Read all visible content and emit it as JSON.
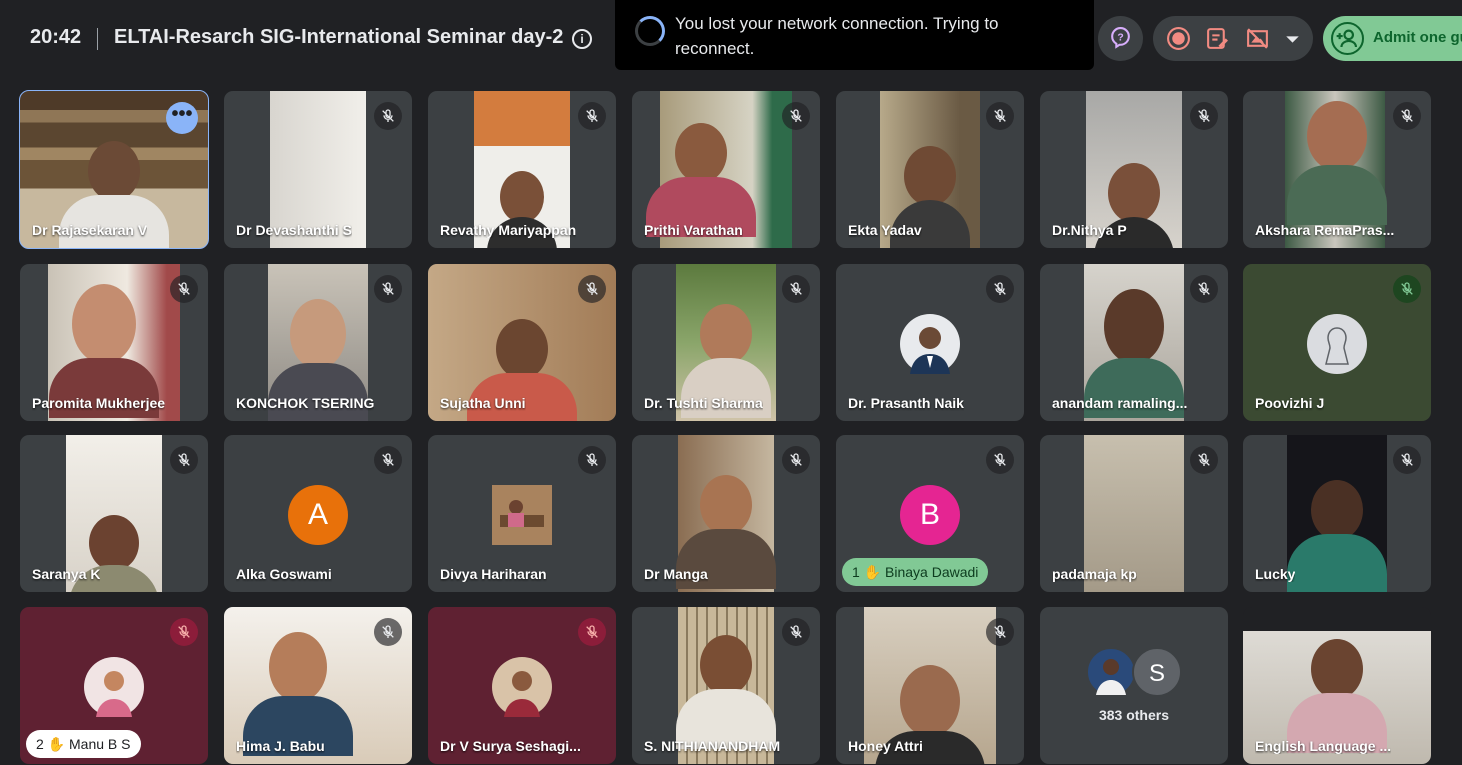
{
  "header": {
    "time": "20:42",
    "meeting_title": "ELTAI-Resarch SIG-International Seminar day-2",
    "info_icon": "info-icon"
  },
  "network_banner": {
    "message": "You lost your network connection. Trying to reconnect."
  },
  "controls": {
    "help_icon": "question-icon",
    "record_icon": "record-icon",
    "notes_icon": "notes-icon",
    "effects_off_icon": "effects-off-icon",
    "dropdown_icon": "chevron-down-icon",
    "admit_label": "Admit one gu"
  },
  "participants": [
    {
      "name": "Dr Rajasekaran V",
      "status": "more"
    },
    {
      "name": "Dr Devashanthi S",
      "status": "muted"
    },
    {
      "name": "Revathy Mariyappan",
      "status": "muted"
    },
    {
      "name": "Prithi Varathan",
      "status": "muted"
    },
    {
      "name": "Ekta Yadav",
      "status": "muted"
    },
    {
      "name": "Dr.Nithya P",
      "status": "muted"
    },
    {
      "name": "Akshara RemaPras...",
      "status": "muted"
    },
    {
      "name": "Paromita Mukherjee",
      "status": "muted"
    },
    {
      "name": "KONCHOK TSERING",
      "status": "muted"
    },
    {
      "name": "Sujatha Unni",
      "status": "muted"
    },
    {
      "name": "Dr. Tushti Sharma",
      "status": "muted"
    },
    {
      "name": "Dr. Prasanth Naik",
      "status": "muted"
    },
    {
      "name": "anandam ramaling...",
      "status": "muted"
    },
    {
      "name": "Poovizhi J",
      "status": "muted"
    },
    {
      "name": "Saranya K",
      "status": "muted"
    },
    {
      "name": "Alka Goswami",
      "status": "muted",
      "initial": "A"
    },
    {
      "name": "Divya Hariharan",
      "status": "muted"
    },
    {
      "name": "Dr Manga",
      "status": "muted"
    },
    {
      "name": "Binaya Dawadi",
      "status": "muted",
      "initial": "B",
      "hand_count": "1"
    },
    {
      "name": "padamaja kp",
      "status": "muted"
    },
    {
      "name": "Lucky",
      "status": "muted"
    },
    {
      "name": "Manu B S",
      "status": "muted",
      "hand_count": "2"
    },
    {
      "name": "Hima J. Babu",
      "status": "muted"
    },
    {
      "name": "Dr V Surya Seshagi...",
      "status": "muted"
    },
    {
      "name": "S. NITHIANANDHAM",
      "status": "muted"
    },
    {
      "name": "Honey Attri",
      "status": "muted"
    },
    {
      "name": "383 others",
      "status": "none",
      "initial": "S"
    },
    {
      "name": "English Language ...",
      "status": "none"
    }
  ],
  "colors": {
    "background": "#202124",
    "tile": "#3c4043",
    "accent_blue": "#8ab4f8",
    "admit_green": "#81c995",
    "avatar_orange": "#e8710a",
    "avatar_pink": "#e52592",
    "avatar_slate": "#5f6368"
  }
}
